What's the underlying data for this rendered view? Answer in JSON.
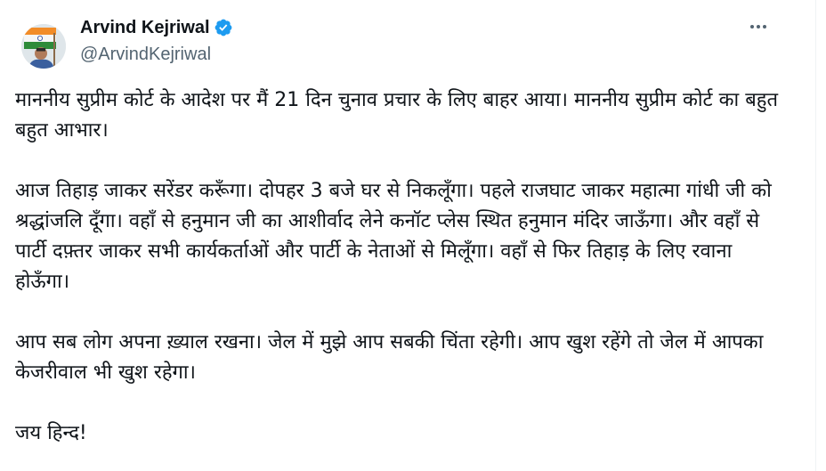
{
  "author": {
    "display_name": "Arvind Kejriwal",
    "handle": "@ArvindKejriwal",
    "verified": true,
    "verified_color": "#1d9bf0"
  },
  "menu": {
    "more_icon": "ellipsis-icon"
  },
  "tweet": {
    "paragraphs": [
      "माननीय सुप्रीम कोर्ट के आदेश पर मैं 21 दिन चुनाव प्रचार के लिए बाहर आया। माननीय सुप्रीम कोर्ट का बहुत बहुत आभार।",
      "आज तिहाड़ जाकर सरेंडर करूँगा। दोपहर 3 बजे घर से निकलूँगा। पहले राजघाट जाकर महात्मा गांधी जी को श्रद्धांजलि दूँगा। वहाँ से हनुमान जी का आशीर्वाद लेने कनॉट प्लेस स्थित हनुमान मंदिर जाऊँगा। और वहाँ से पार्टी दफ़्तर जाकर सभी कार्यकर्ताओं और पार्टी के नेताओं से मिलूँगा। वहाँ से फिर तिहाड़ के लिए रवाना होऊँगा।",
      "आप सब लोग अपना ख़्याल रखना। जेल में मुझे आप सबकी चिंता रहेगी। आप खुश रहेंगे तो जेल में आपका केजरीवाल भी खुश रहेगा।",
      "जय हिन्द!"
    ]
  }
}
